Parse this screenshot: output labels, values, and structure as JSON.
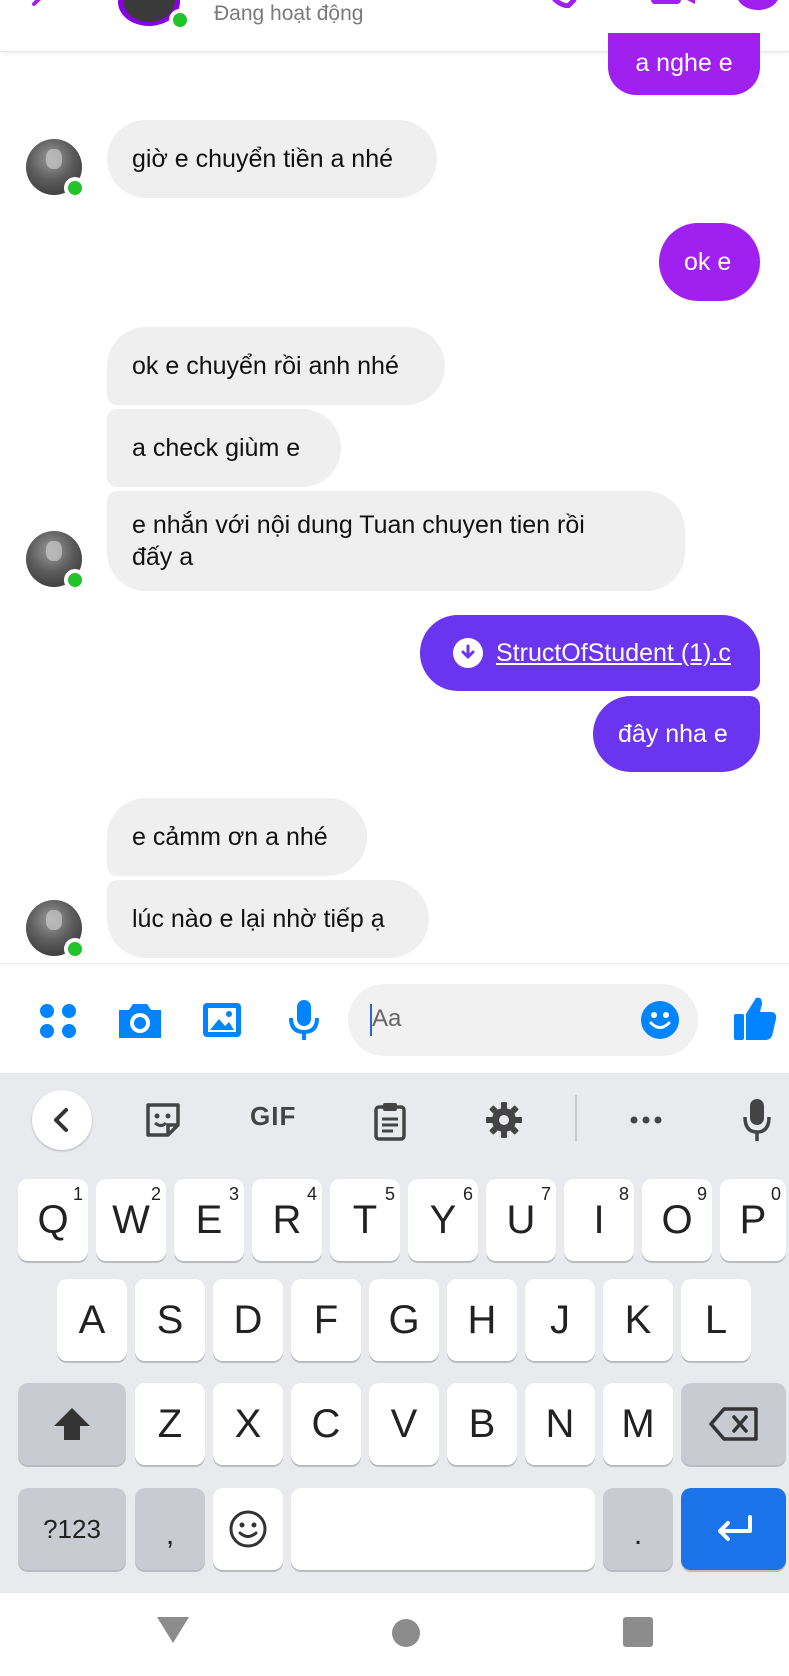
{
  "header": {
    "status": "Đang hoạt động"
  },
  "messages": [
    {
      "id": "m0",
      "text": "a nghe e"
    },
    {
      "id": "m1",
      "text": "giờ e chuyển tiền a nhé"
    },
    {
      "id": "m2",
      "text": "ok e"
    },
    {
      "id": "m3",
      "text": "ok e chuyển rồi anh nhé"
    },
    {
      "id": "m4",
      "text": "a check giùm e"
    },
    {
      "id": "m5",
      "line1": "e nhắn với nội dung Tuan chuyen tien rồi",
      "line2": "đấy a"
    },
    {
      "id": "m6",
      "text": "StructOfStudent (1).c"
    },
    {
      "id": "m7",
      "text": "đây nha e"
    },
    {
      "id": "m8",
      "text": "e cảmm ơn a nhé"
    },
    {
      "id": "m9",
      "text": "lúc nào e lại nhờ tiếp ạ"
    }
  ],
  "composer": {
    "placeholder": "Aa"
  },
  "keyboard": {
    "gif_label": "GIF",
    "row1": [
      {
        "label": "Q",
        "hint": "1"
      },
      {
        "label": "W",
        "hint": "2"
      },
      {
        "label": "E",
        "hint": "3"
      },
      {
        "label": "R",
        "hint": "4"
      },
      {
        "label": "T",
        "hint": "5"
      },
      {
        "label": "Y",
        "hint": "6"
      },
      {
        "label": "U",
        "hint": "7"
      },
      {
        "label": "I",
        "hint": "8"
      },
      {
        "label": "O",
        "hint": "9"
      },
      {
        "label": "P",
        "hint": "0"
      }
    ],
    "row2": [
      "A",
      "S",
      "D",
      "F",
      "G",
      "H",
      "J",
      "K",
      "L"
    ],
    "row3": [
      "Z",
      "X",
      "C",
      "V",
      "B",
      "N",
      "M"
    ],
    "symbols_label": "?123",
    "comma_label": ",",
    "period_label": "."
  },
  "colors": {
    "outgoing_purple": "#a020f0",
    "outgoing_indigo": "#6b35f0",
    "incoming": "#efefef",
    "messenger_blue": "#0084ff",
    "online_green": "#22c32b",
    "enter_key": "#1a73e8"
  }
}
